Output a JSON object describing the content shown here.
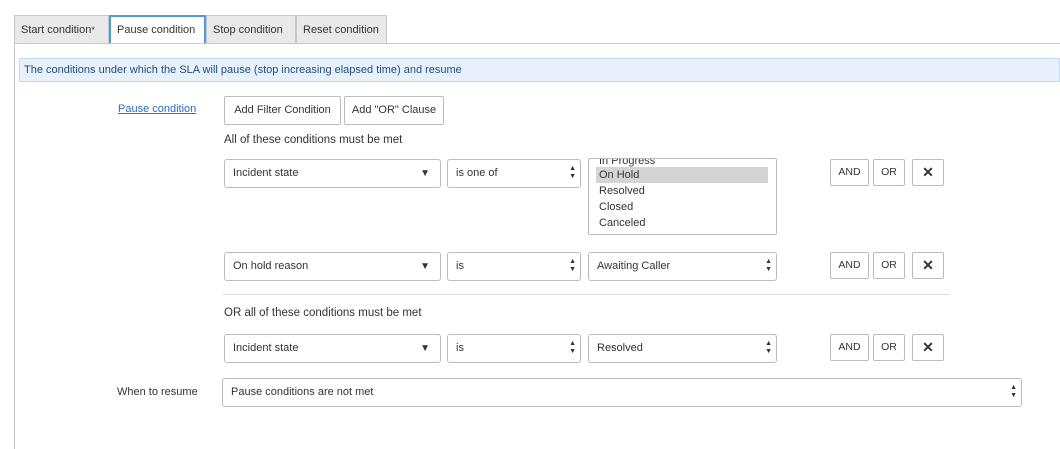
{
  "tabs": [
    {
      "label": "Start condition",
      "required_mark": "*"
    },
    {
      "label": "Pause condition"
    },
    {
      "label": "Stop condition"
    },
    {
      "label": "Reset condition"
    }
  ],
  "banner": "The conditions under which the SLA will pause (stop increasing elapsed time) and resume",
  "pause_link": "Pause condition",
  "buttons": {
    "add_filter": "Add Filter Condition",
    "add_or": "Add \"OR\" Clause"
  },
  "group1_heading": "All of these conditions must be met",
  "group2_heading": "OR all of these conditions must be met",
  "rows": [
    {
      "field": "Incident state",
      "operator": "is one of",
      "value": ""
    },
    {
      "field": "On hold reason",
      "operator": "is",
      "value": "Awaiting Caller"
    },
    {
      "field": "Incident state",
      "operator": "is",
      "value": "Resolved"
    }
  ],
  "listbox_options": [
    "In Progress",
    "On Hold",
    "Resolved",
    "Closed",
    "Canceled"
  ],
  "listbox_selected": "On Hold",
  "row_buttons": {
    "and": "AND",
    "or": "OR",
    "remove": "✕"
  },
  "resume": {
    "label": "When to resume",
    "value": "Pause conditions are not met"
  }
}
